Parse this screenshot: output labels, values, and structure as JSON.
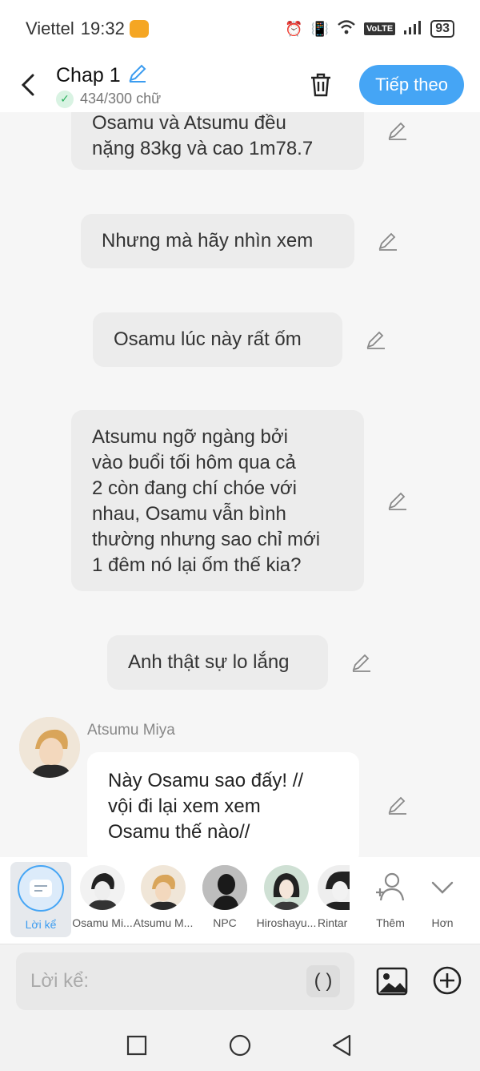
{
  "status": {
    "carrier": "Viettel",
    "time": "19:32",
    "battery": "93",
    "volte": "VoLTE"
  },
  "header": {
    "back_icon": "chevron-left",
    "title": "Chap 1",
    "word_count": "434/300 chữ",
    "next_label": "Tiếp theo"
  },
  "messages": [
    {
      "text_lines": [
        "Osamu và Atsumu đều",
        "nặng 83kg và cao 1m78.7"
      ]
    },
    {
      "text_lines": [
        "Nhưng mà hãy nhìn xem"
      ]
    },
    {
      "text_lines": [
        "Osamu lúc này rất ốm"
      ]
    },
    {
      "text_lines": [
        "Atsumu ngỡ ngàng bởi",
        "vào buổi tối hôm qua cả",
        "2 còn đang chí chóe với",
        "nhau, Osamu vẫn bình",
        "thường nhưng sao chỉ mới",
        "1 đêm nó lại ốm thế kia?"
      ]
    },
    {
      "text_lines": [
        "Anh thật sự lo lắng"
      ]
    },
    {
      "speaker": "Atsumu Miya",
      "text_lines": [
        "Này Osamu sao đấy! //",
        "vội đi lại xem xem",
        "Osamu thế nào//"
      ]
    }
  ],
  "characters": [
    {
      "name": "Lời kể",
      "active": true
    },
    {
      "name": "Osamu Mi..."
    },
    {
      "name": "Atsumu M..."
    },
    {
      "name": "NPC"
    },
    {
      "name": "Hiroshayu..."
    },
    {
      "name": "Rintar"
    }
  ],
  "actions": {
    "add_label": "Thêm",
    "more_label": "Hơn"
  },
  "input": {
    "placeholder": "Lời kể:",
    "paren_label": "( )"
  },
  "colors": {
    "accent": "#45a5f5",
    "bubble_gray": "#ececec",
    "check_green": "#27b05a"
  }
}
